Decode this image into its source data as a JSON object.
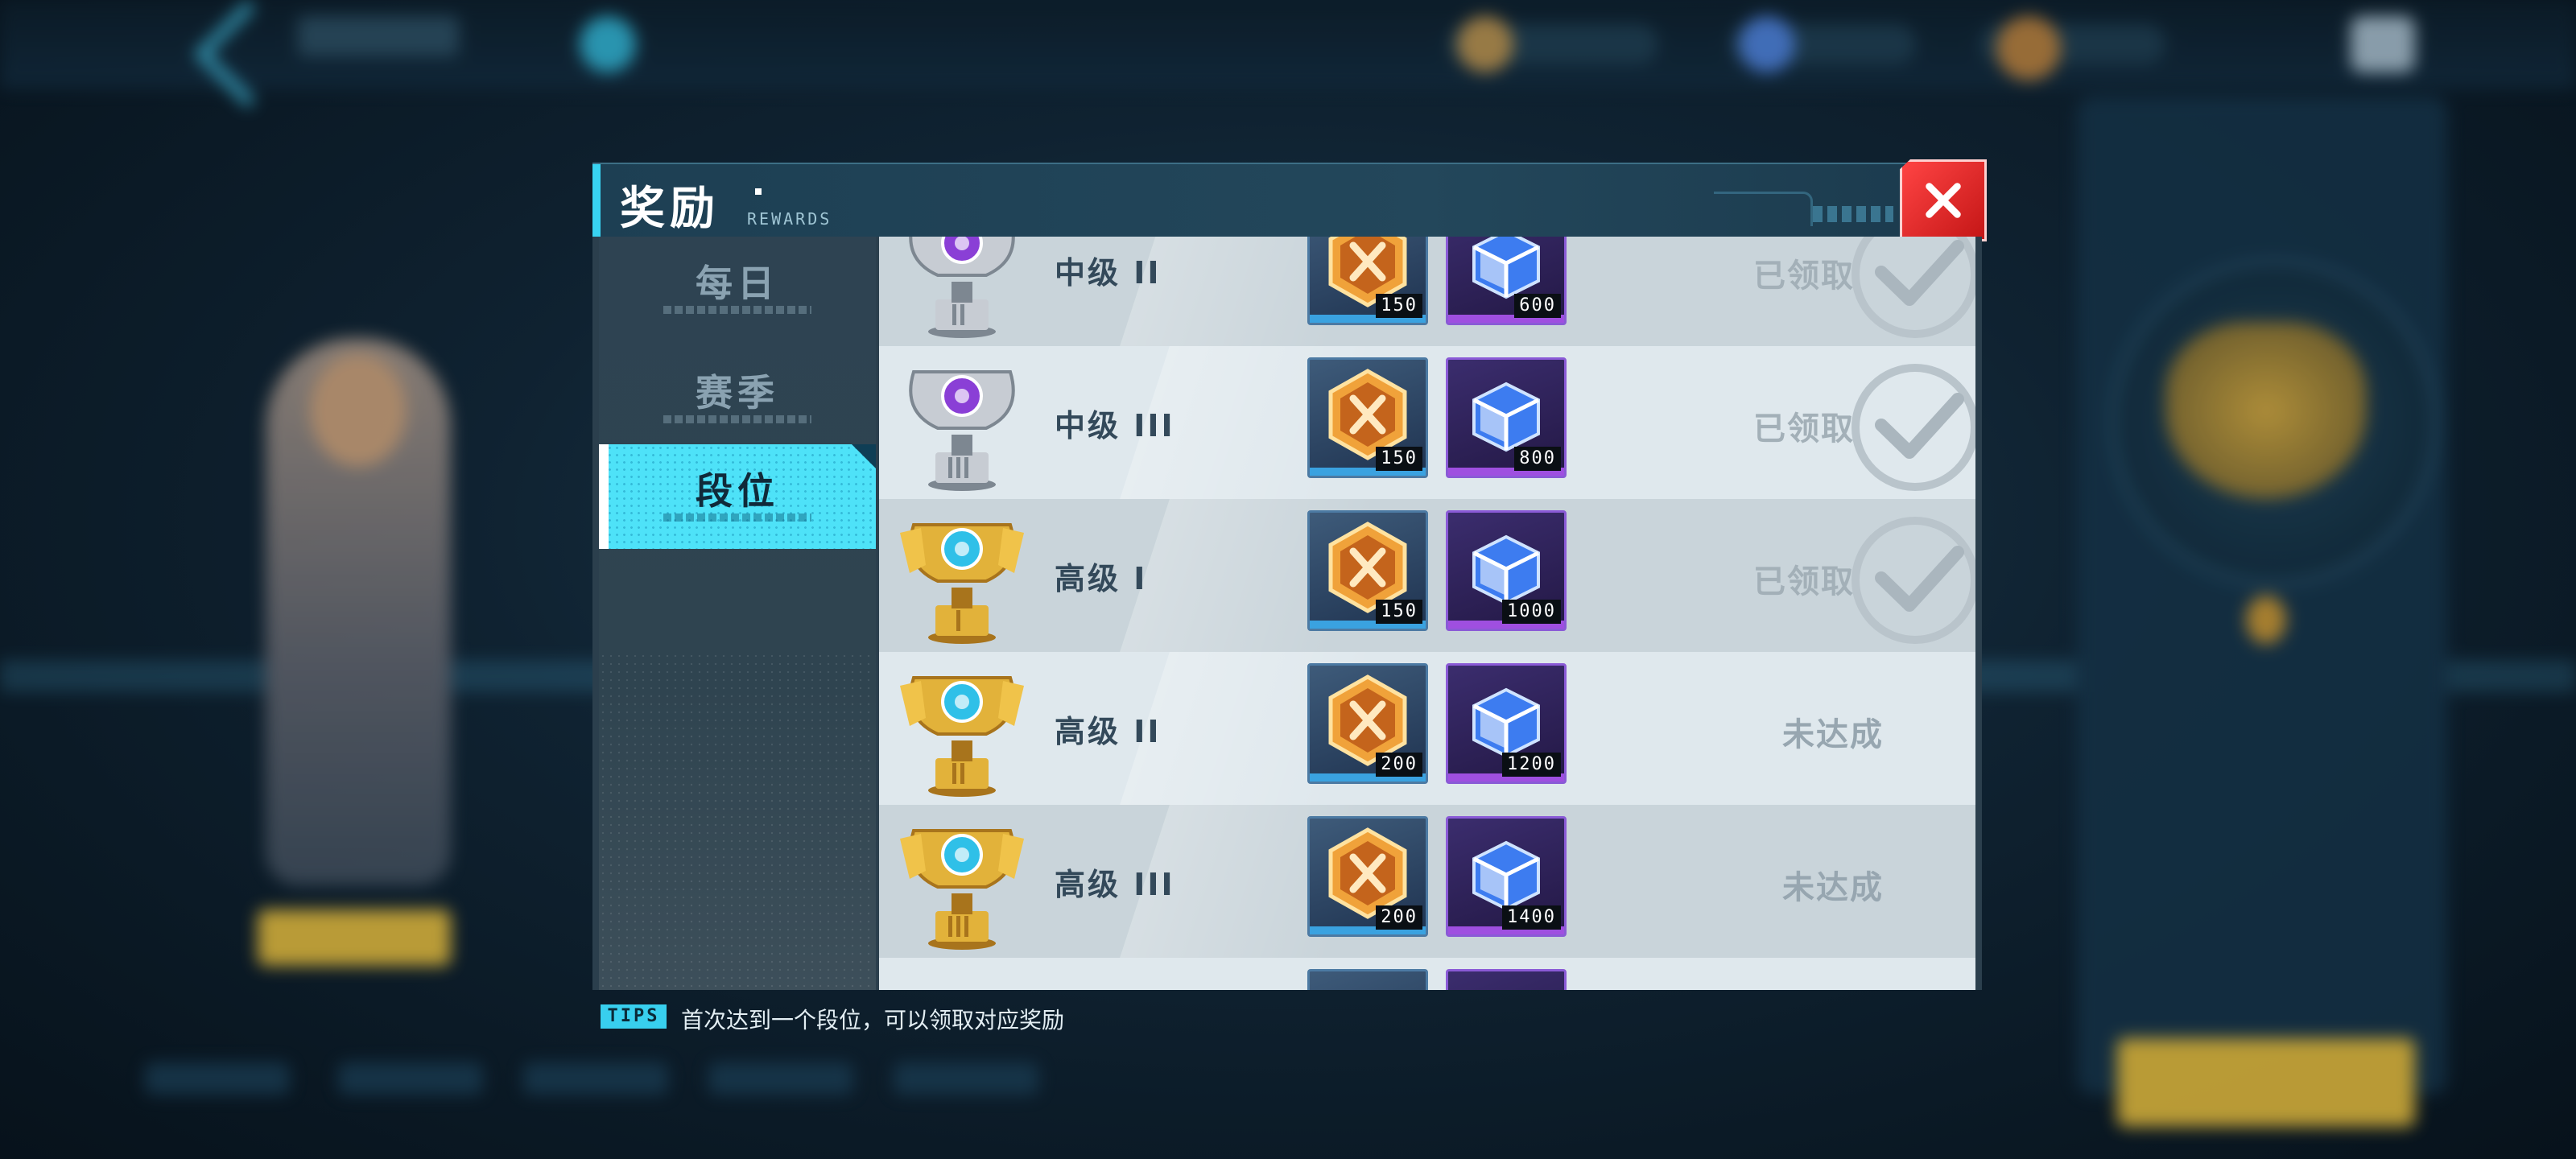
{
  "dialog": {
    "title": "奖励",
    "subtitle": "REWARDS"
  },
  "tabs": [
    {
      "label": "每日",
      "active": false
    },
    {
      "label": "赛季",
      "active": false
    },
    {
      "label": "段位",
      "active": true
    }
  ],
  "rewards": [
    {
      "rank": "中级 II",
      "tier": "silver",
      "coin_qty": "150",
      "cube_qty": "600",
      "status": "已领取",
      "claimed": true
    },
    {
      "rank": "中级 III",
      "tier": "silver",
      "coin_qty": "150",
      "cube_qty": "800",
      "status": "已领取",
      "claimed": true
    },
    {
      "rank": "高级 I",
      "tier": "gold",
      "coin_qty": "150",
      "cube_qty": "1000",
      "status": "已领取",
      "claimed": true
    },
    {
      "rank": "高级 II",
      "tier": "gold",
      "coin_qty": "200",
      "cube_qty": "1200",
      "status": "未达成",
      "claimed": false
    },
    {
      "rank": "高级 III",
      "tier": "gold",
      "coin_qty": "200",
      "cube_qty": "1400",
      "status": "未达成",
      "claimed": false
    }
  ],
  "tips": {
    "tag": "TIPS",
    "text": "首次达到一个段位，可以领取对应奖励"
  },
  "colors": {
    "accent": "#38d3f2",
    "close": "#e02626",
    "silver_tier_gem": "#8a3fd6",
    "gold_tier_gem": "#2fc0e8"
  },
  "icons": [
    "close-icon",
    "trophy-icon",
    "coin-icon",
    "cube-icon",
    "check-icon"
  ]
}
